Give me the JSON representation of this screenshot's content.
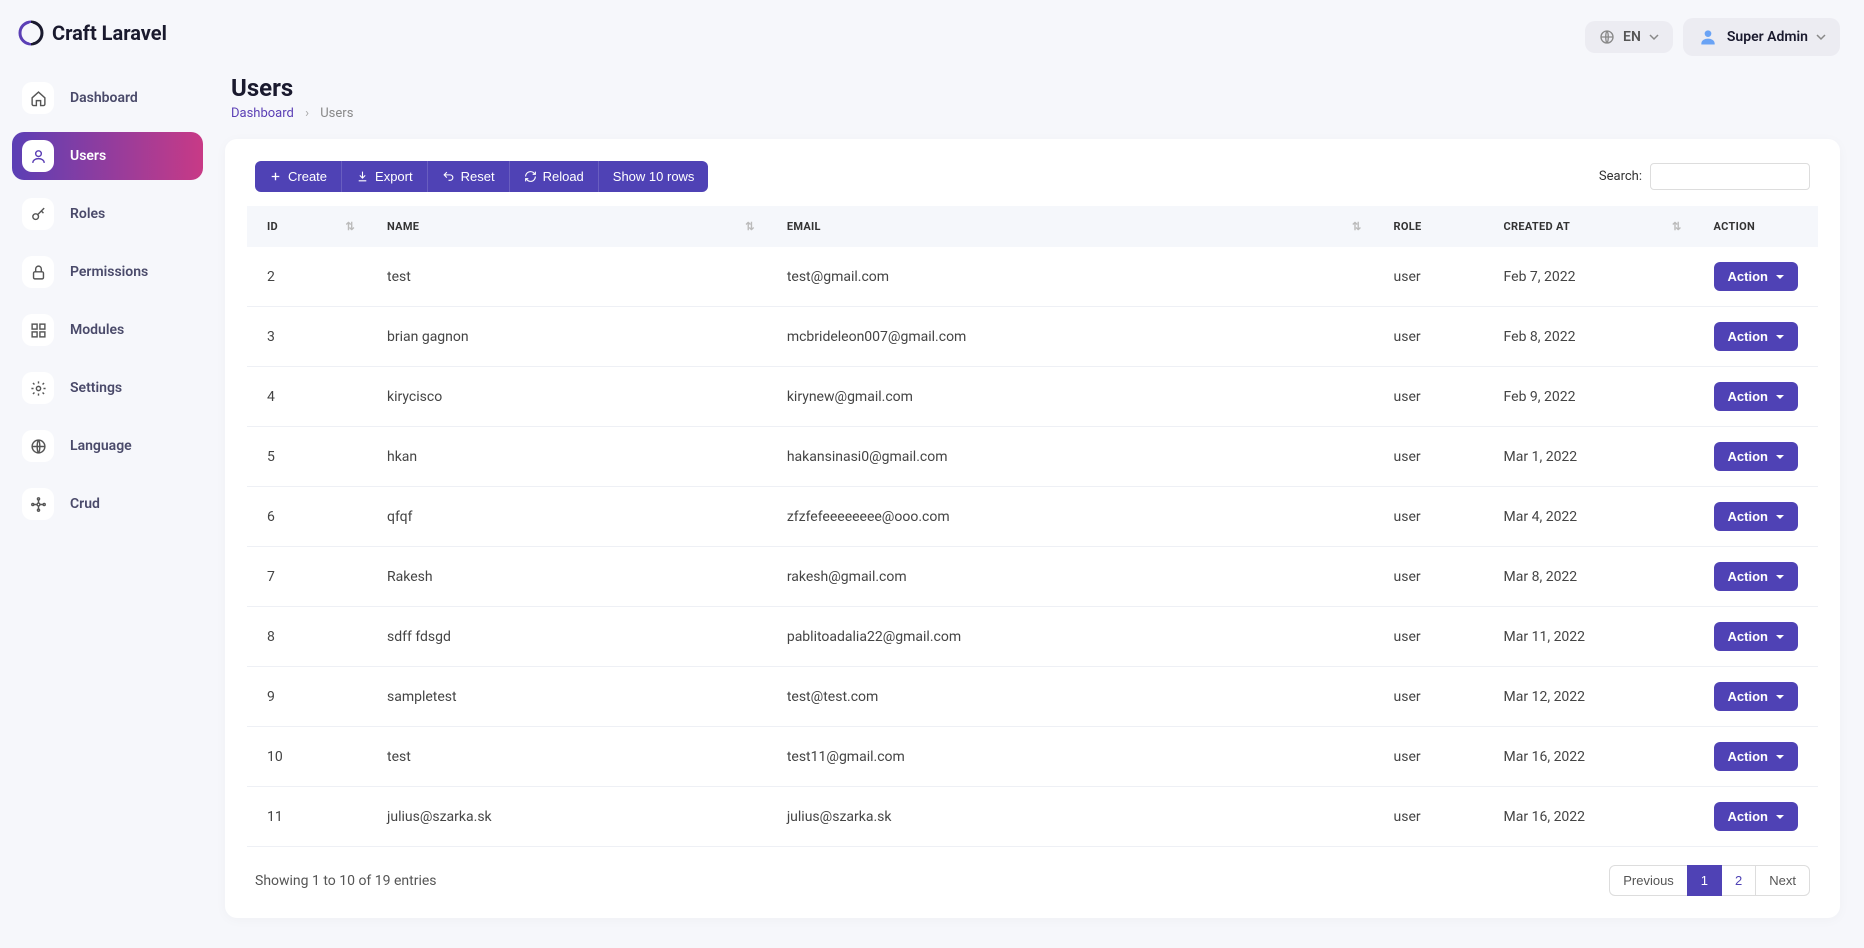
{
  "brand": "Craft Laravel",
  "topbar": {
    "lang_label": "EN",
    "user_label": "Super Admin"
  },
  "sidebar": {
    "items": [
      {
        "label": "Dashboard",
        "icon": "home"
      },
      {
        "label": "Users",
        "icon": "user",
        "active": true
      },
      {
        "label": "Roles",
        "icon": "key"
      },
      {
        "label": "Permissions",
        "icon": "lock"
      },
      {
        "label": "Modules",
        "icon": "modules"
      },
      {
        "label": "Settings",
        "icon": "gear"
      },
      {
        "label": "Language",
        "icon": "globe"
      },
      {
        "label": "Crud",
        "icon": "crud"
      }
    ]
  },
  "page": {
    "title": "Users",
    "breadcrumb_root": "Dashboard",
    "breadcrumb_current": "Users"
  },
  "toolbar": {
    "create": "Create",
    "export": "Export",
    "reset": "Reset",
    "reload": "Reload",
    "show_rows": "Show 10 rows",
    "search_label": "Search:"
  },
  "table": {
    "columns": {
      "id": "ID",
      "name": "NAME",
      "email": "EMAIL",
      "role": "ROLE",
      "created_at": "CREATED AT",
      "action": "ACTION"
    },
    "action_label": "Action",
    "rows": [
      {
        "id": "2",
        "name": "test",
        "email": "test@gmail.com",
        "role": "user",
        "created_at": "Feb 7, 2022"
      },
      {
        "id": "3",
        "name": "brian gagnon",
        "email": "mcbrideleon007@gmail.com",
        "role": "user",
        "created_at": "Feb 8, 2022"
      },
      {
        "id": "4",
        "name": "kirycisco",
        "email": "kirynew@gmail.com",
        "role": "user",
        "created_at": "Feb 9, 2022"
      },
      {
        "id": "5",
        "name": "hkan",
        "email": "hakansinasi0@gmail.com",
        "role": "user",
        "created_at": "Mar 1, 2022"
      },
      {
        "id": "6",
        "name": "qfqf",
        "email": "zfzfefeeeeeeee@ooo.com",
        "role": "user",
        "created_at": "Mar 4, 2022"
      },
      {
        "id": "7",
        "name": "Rakesh",
        "email": "rakesh@gmail.com",
        "role": "user",
        "created_at": "Mar 8, 2022"
      },
      {
        "id": "8",
        "name": "sdff fdsgd",
        "email": "pablitoadalia22@gmail.com",
        "role": "user",
        "created_at": "Mar 11, 2022"
      },
      {
        "id": "9",
        "name": "sampletest",
        "email": "test@test.com",
        "role": "user",
        "created_at": "Mar 12, 2022"
      },
      {
        "id": "10",
        "name": "test",
        "email": "test11@gmail.com",
        "role": "user",
        "created_at": "Mar 16, 2022"
      },
      {
        "id": "11",
        "name": "julius@szarka.sk",
        "email": "julius@szarka.sk",
        "role": "user",
        "created_at": "Mar 16, 2022"
      }
    ]
  },
  "footer": {
    "info": "Showing 1 to 10 of 19 entries",
    "prev": "Previous",
    "next": "Next",
    "pages": [
      "1",
      "2"
    ],
    "active_page": "1"
  }
}
